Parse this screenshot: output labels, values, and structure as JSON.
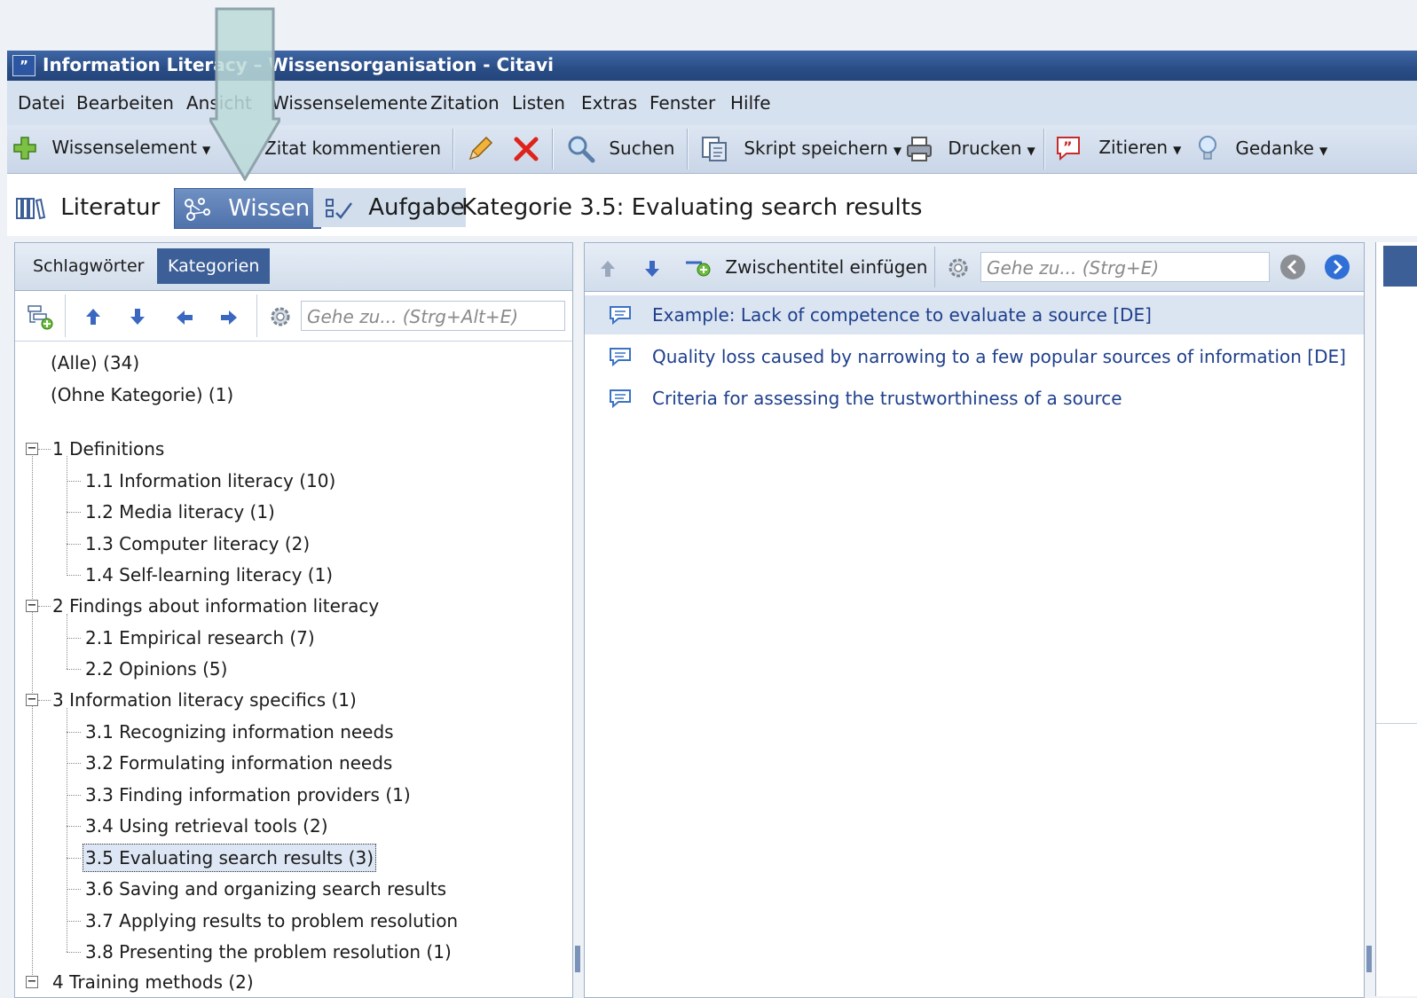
{
  "window": {
    "title": "Information Literacy – Wissensorganisation - Citavi"
  },
  "menu": [
    "Datei",
    "Bearbeiten",
    "Ansicht",
    "Wissenselemente",
    "Zitation",
    "Listen",
    "Extras",
    "Fenster",
    "Hilfe"
  ],
  "toolbar": {
    "wissenselement": "Wissenselement",
    "zitat_kommentieren": "Zitat kommentieren",
    "suchen": "Suchen",
    "skript_speichern": "Skript speichern",
    "drucken": "Drucken",
    "zitieren": "Zitieren",
    "gedanke": "Gedanke"
  },
  "nav": {
    "literatur": "Literatur",
    "wissen": "Wissen",
    "aufgaben": "Aufgaben",
    "category_title": "Kategorie 3.5:  Evaluating search results"
  },
  "left_panel": {
    "tabs": [
      "Schlagwörter",
      "Kategorien"
    ],
    "active_tab": "Kategorien",
    "search_placeholder": "Gehe zu... (Strg+Alt+E)",
    "tree": {
      "all": "(Alle) (34)",
      "none": "(Ohne Kategorie) (1)",
      "groups": [
        {
          "label": "1 Definitions",
          "children": [
            "1.1 Information literacy (10)",
            "1.2 Media literacy (1)",
            "1.3 Computer literacy (2)",
            "1.4 Self-learning literacy (1)"
          ]
        },
        {
          "label": "2 Findings about information literacy",
          "children": [
            "2.1 Empirical research (7)",
            "2.2 Opinions (5)"
          ]
        },
        {
          "label": "3 Information literacy specifics (1)",
          "children": [
            "3.1 Recognizing information needs",
            "3.2 Formulating information needs",
            "3.3 Finding information providers (1)",
            "3.4 Using retrieval tools (2)",
            "3.5 Evaluating search results (3)",
            "3.6 Saving and organizing search results",
            "3.7 Applying results to problem resolution",
            "3.8 Presenting the problem resolution (1)"
          ]
        },
        {
          "label": "4 Training methods (2)",
          "children": []
        }
      ],
      "selected": "3.5 Evaluating search results (3)"
    }
  },
  "center_panel": {
    "insert_subheading": "Zwischentitel einfügen",
    "search_placeholder": "Gehe zu... (Strg+E)",
    "items": [
      "Example: Lack of competence to evaluate a source [DE]",
      "Quality loss caused by narrowing to a few popular sources of information [DE]",
      "Criteria for assessing the trustworthiness of a source"
    ]
  },
  "colors": {
    "title_bar": "#2a4d86",
    "menu_bg": "#d6e1ef",
    "accent": "#3c5f97",
    "link_text": "#1e3f8c",
    "arrow_fill": "#bcdad8",
    "arrow_stroke": "#8fa3ad"
  }
}
